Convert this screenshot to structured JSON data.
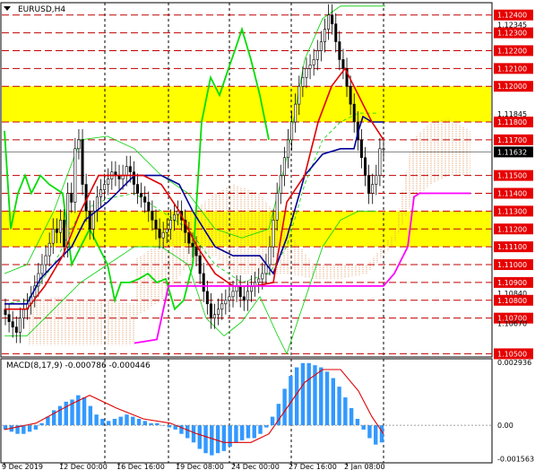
{
  "title": "EURUSD,H4",
  "macd_title": "MACD(8,17,9) -0.000786 -0.000446",
  "current_price_label": "1.11632",
  "price_labels": [
    {
      "text": "1.12400",
      "boxed": true
    },
    {
      "text": "1.12345",
      "boxed": false
    },
    {
      "text": "1.12300",
      "boxed": true
    },
    {
      "text": "1.12200",
      "boxed": true
    },
    {
      "text": "1.12100",
      "boxed": true
    },
    {
      "text": "1.12000",
      "boxed": true
    },
    {
      "text": "1.11845",
      "boxed": false
    },
    {
      "text": "1.11800",
      "boxed": true
    },
    {
      "text": "1.11700",
      "boxed": true
    },
    {
      "text": "1.11632",
      "boxed": true,
      "current": true
    },
    {
      "text": "1.11500",
      "boxed": true
    },
    {
      "text": "1.11400",
      "boxed": true
    },
    {
      "text": "1.11300",
      "boxed": true
    },
    {
      "text": "1.11200",
      "boxed": true
    },
    {
      "text": "1.11100",
      "boxed": true
    },
    {
      "text": "1.11000",
      "boxed": true
    },
    {
      "text": "1.10900",
      "boxed": true
    },
    {
      "text": "1.10840",
      "boxed": false
    },
    {
      "text": "1.10800",
      "boxed": true
    },
    {
      "text": "1.10700",
      "boxed": true
    },
    {
      "text": "1.10670",
      "boxed": false
    },
    {
      "text": "1.10500",
      "boxed": true
    }
  ],
  "macd_labels": [
    "0.002936",
    "0.00",
    "-0.001563"
  ],
  "time_labels": [
    "9 Dec 2019",
    "12 Dec 00:00",
    "16 Dec 16:00",
    "19 Dec 08:00",
    "24 Dec 00:00",
    "27 Dec 16:00",
    "2 Jan 08:00"
  ],
  "colors": {
    "zone": "#ffff00",
    "level_line": "#c00000",
    "label_box": "#e60000",
    "current_box": "#000000",
    "bollinger": "#00d000",
    "kijun": "#000099",
    "tenkan": "#e00000",
    "chikou": "#00dd00",
    "senkou_b": "#ff00ff",
    "cloud": "#e0a070",
    "macd_hist": "#3399ff",
    "macd_signal": "#e00000"
  }
}
